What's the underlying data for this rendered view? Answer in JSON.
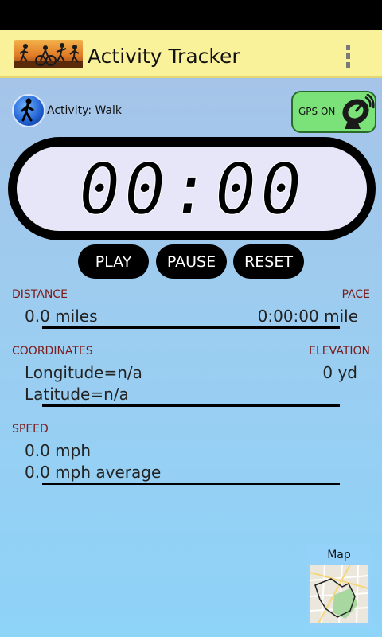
{
  "app": {
    "title": "Activity Tracker"
  },
  "activity": {
    "label": "Activity: Walk"
  },
  "gps": {
    "label": "GPS ON"
  },
  "timer": {
    "display": "00:00"
  },
  "controls": {
    "play": "PLAY",
    "pause": "PAUSE",
    "reset": "RESET"
  },
  "stats": {
    "distance_label": "DISTANCE",
    "distance_value": "0.0 miles",
    "pace_label": "PACE",
    "pace_value": "0:00:00 mile",
    "coordinates_label": "COORDINATES",
    "longitude": "Longitude=n/a",
    "latitude": "Latitude=n/a",
    "elevation_label": "ELEVATION",
    "elevation_value": "0 yd",
    "speed_label": "SPEED",
    "speed_value": "0.0 mph",
    "speed_average": "0.0 mph average"
  },
  "map": {
    "label": "Map"
  },
  "colors": {
    "action_bar": "#faf29a",
    "gps_on": "#7be27a",
    "section_label": "#7d1a1a"
  }
}
